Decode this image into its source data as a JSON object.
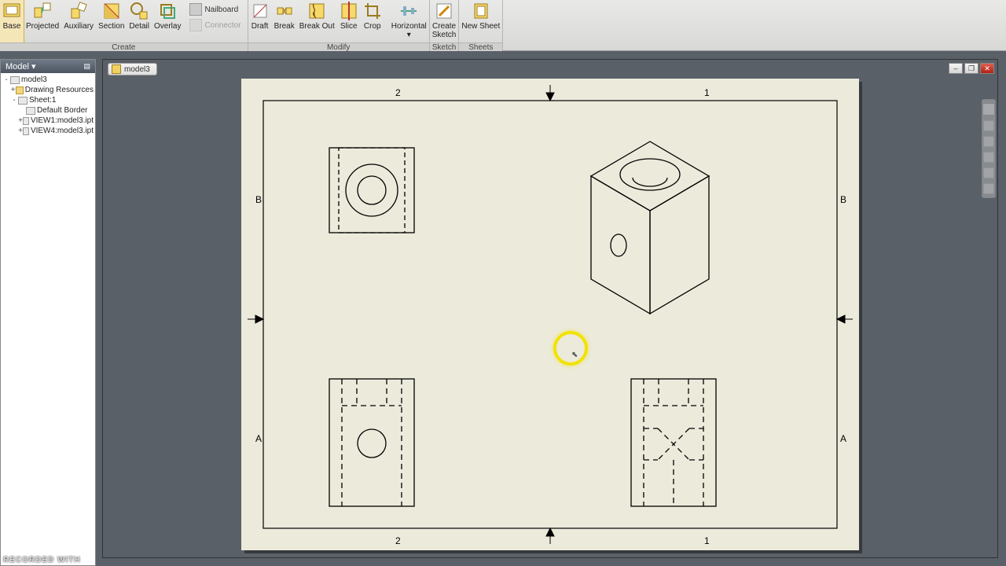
{
  "ribbon": {
    "groups": [
      {
        "label": "Create",
        "buttons": [
          {
            "id": "base",
            "label": "Base"
          },
          {
            "id": "projected",
            "label": "Projected"
          },
          {
            "id": "auxiliary",
            "label": "Auxiliary"
          },
          {
            "id": "section",
            "label": "Section"
          },
          {
            "id": "detail",
            "label": "Detail"
          },
          {
            "id": "overlay",
            "label": "Overlay"
          }
        ],
        "small": [
          {
            "id": "nailboard",
            "label": "Nailboard",
            "enabled": true
          },
          {
            "id": "connector",
            "label": "Connector",
            "enabled": false
          }
        ]
      },
      {
        "label": "Modify",
        "buttons": [
          {
            "id": "draft",
            "label": "Draft"
          },
          {
            "id": "break",
            "label": "Break"
          },
          {
            "id": "breakout",
            "label": "Break Out"
          },
          {
            "id": "slice",
            "label": "Slice"
          },
          {
            "id": "crop",
            "label": "Crop"
          },
          {
            "id": "horizontal",
            "label": "Horizontal\n▾"
          }
        ]
      },
      {
        "label": "Sketch",
        "buttons": [
          {
            "id": "createsketch",
            "label": "Create\nSketch"
          }
        ]
      },
      {
        "label": "Sheets",
        "buttons": [
          {
            "id": "newsheet",
            "label": "New Sheet"
          }
        ]
      }
    ]
  },
  "tree": {
    "header": "Model ▾",
    "root": "model3",
    "items": [
      {
        "indent": 1,
        "icon": "folder",
        "label": "Drawing Resources",
        "twist": "+"
      },
      {
        "indent": 1,
        "icon": "doc",
        "label": "Sheet:1",
        "twist": "-"
      },
      {
        "indent": 2,
        "icon": "doc",
        "label": "Default Border",
        "twist": ""
      },
      {
        "indent": 2,
        "icon": "doc",
        "label": "VIEW1:model3.ipt",
        "twist": "+"
      },
      {
        "indent": 2,
        "icon": "doc",
        "label": "VIEW4:model3.ipt",
        "twist": "+"
      }
    ]
  },
  "document": {
    "title": "model3"
  },
  "sheet": {
    "zones": {
      "col_left": "2",
      "col_right": "1",
      "row_top": "B",
      "row_bottom": "A"
    }
  },
  "watermark": "RECORDED WITH"
}
